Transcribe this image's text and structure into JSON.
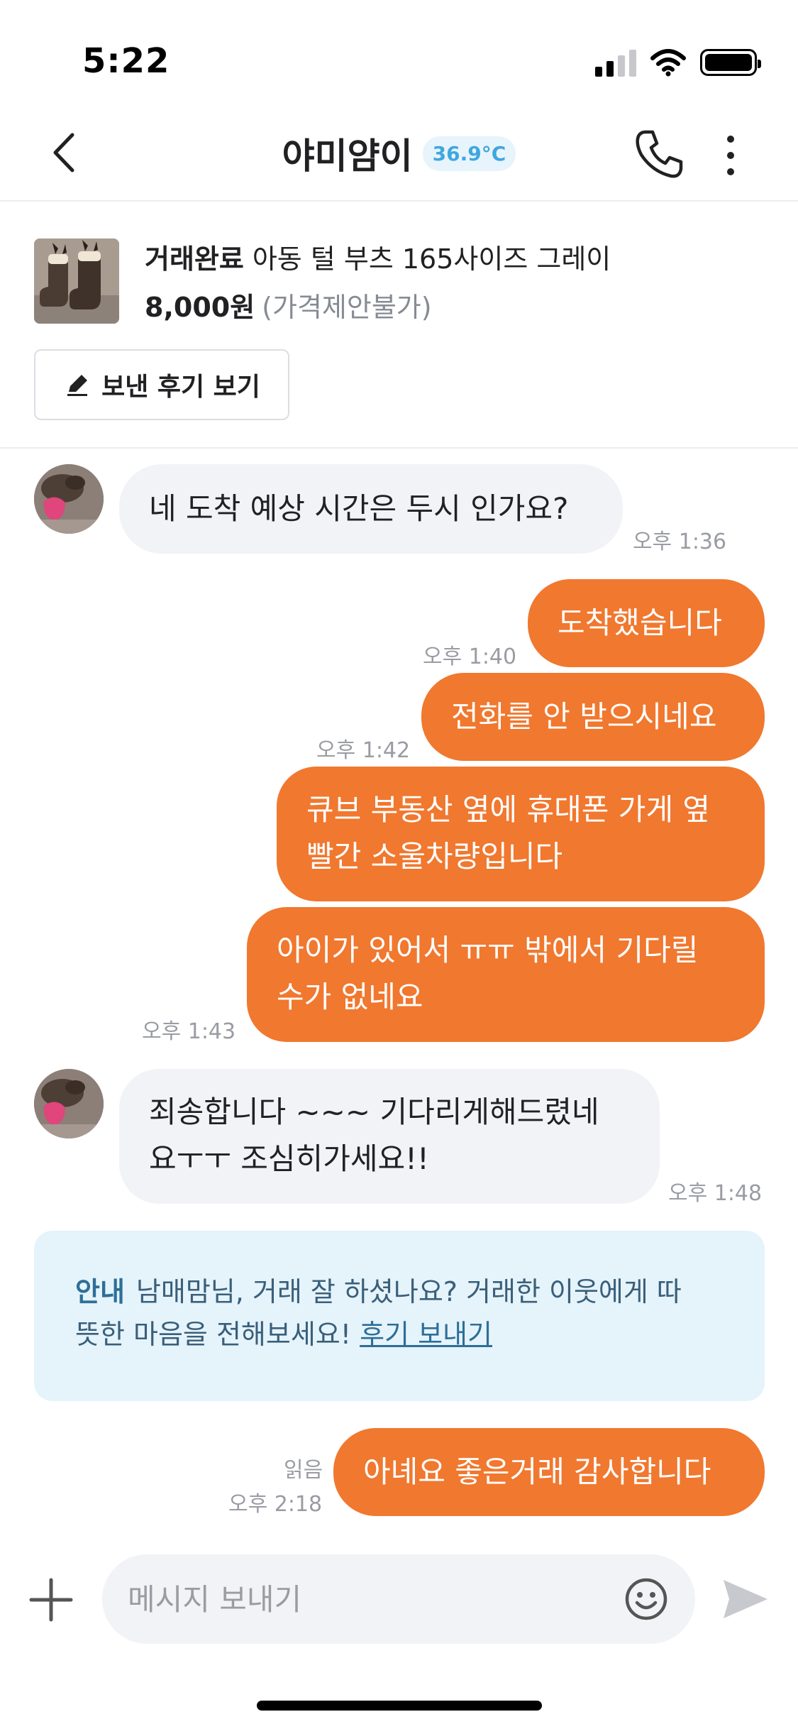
{
  "status_bar": {
    "time": "5:22"
  },
  "header": {
    "title": "야미얌이",
    "temperature": "36.9°C",
    "accent": "#3fa7e0"
  },
  "product": {
    "status": "거래완료",
    "name": "아동 털 부츠 165사이즈 그레이",
    "price": "8,000원",
    "price_note": "(가격제안불가)",
    "review_button_label": "보낸 후기 보기"
  },
  "messages": [
    {
      "side": "in",
      "text": "네 도착 예상 시간은 두시 인가요?",
      "time": "오후 1:36"
    },
    {
      "side": "out",
      "text": "도착했습니다",
      "time": "오후 1:40"
    },
    {
      "side": "out",
      "text": "전화를 안 받으시네요",
      "time": "오후 1:42"
    },
    {
      "side": "out",
      "lines": [
        "큐브 부동산 옆에 휴대폰 가게 옆",
        "빨간 소울차량입니다"
      ]
    },
    {
      "side": "out",
      "lines": [
        "아이가 있어서 ㅠㅠ 밖에서 기다릴",
        "수가 없네요"
      ],
      "time": "오후 1:43"
    },
    {
      "side": "in",
      "lines": [
        "죄송합니다 ~~~ 기다리게해드렸네",
        "요ㅜㅜ 조심히가세요!!"
      ],
      "time": "오후 1:48"
    }
  ],
  "notice": {
    "tag": "안내",
    "lines": [
      "남매맘님, 거래 잘 하셨나요? 거래한 이웃에게 따",
      "뜻한 마음을 전해보세요!"
    ],
    "link": "후기 보내기"
  },
  "last_message": {
    "text": "아녜요 좋은거래 감사합니다",
    "read": "읽음",
    "time": "오후 2:18"
  },
  "composer": {
    "placeholder": "메시지 보내기"
  },
  "colors": {
    "outgoing": "#f0782f",
    "incoming": "#f2f3f6",
    "notice_bg": "#e5f3fb"
  },
  "icons": [
    "back-arrow-icon",
    "phone-icon",
    "more-vertical-icon",
    "pencil-icon",
    "plus-icon",
    "emoji-icon",
    "send-icon",
    "wifi-icon",
    "battery-icon",
    "signal-icon"
  ]
}
